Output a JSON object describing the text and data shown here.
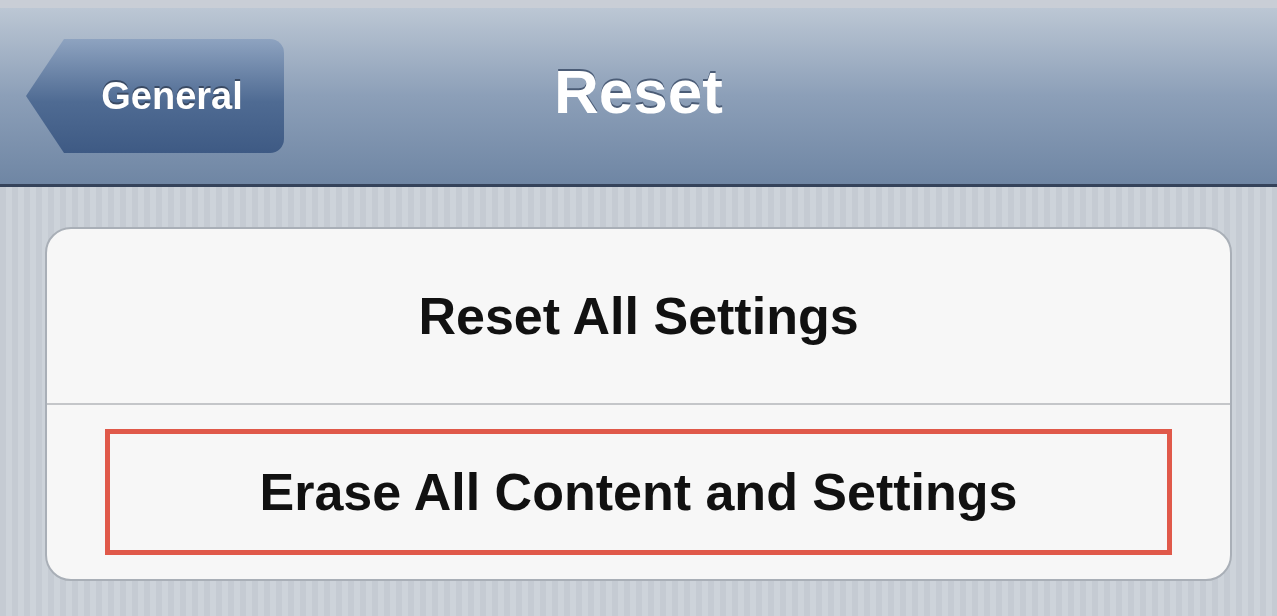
{
  "nav_bar": {
    "back_button": "General",
    "title": "Reset"
  },
  "options": [
    {
      "label": "Reset All Settings",
      "highlighted": false
    },
    {
      "label": "Erase All Content and Settings",
      "highlighted": true
    }
  ]
}
